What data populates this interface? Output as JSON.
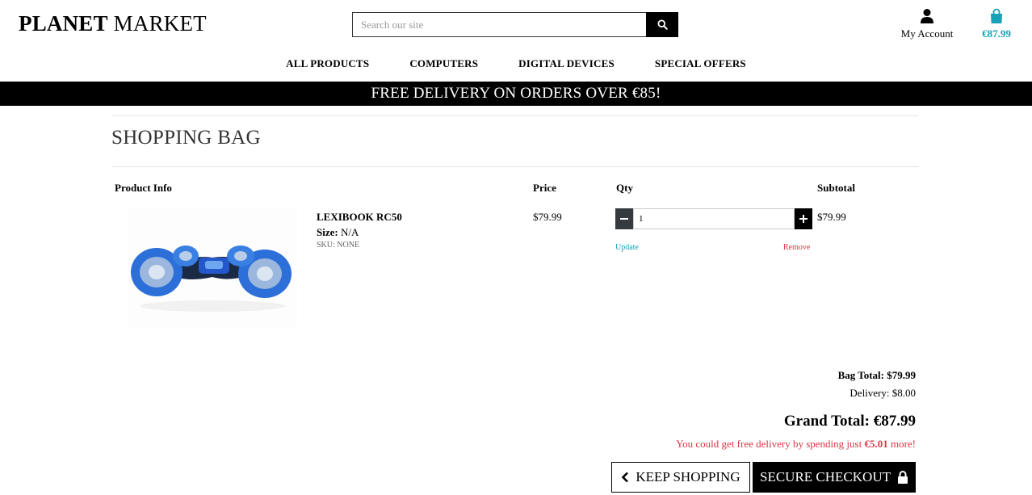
{
  "header": {
    "logo_bold": "PLANET",
    "logo_light": "MARKET",
    "search_placeholder": "Search our site",
    "account_label": "My Account",
    "bag_total": "€87.99",
    "colors": {
      "accent": "#17a2b8",
      "danger": "#dc3545"
    }
  },
  "nav": {
    "items": [
      "ALL PRODUCTS",
      "COMPUTERS",
      "DIGITAL DEVICES",
      "SPECIAL OFFERS"
    ]
  },
  "banner": "FREE DELIVERY ON ORDERS OVER €85!",
  "bag": {
    "title": "SHOPPING BAG",
    "columns": [
      "Product Info",
      "Price",
      "Qty",
      "Subtotal"
    ],
    "item": {
      "name": "LEXIBOOK RC50",
      "size_label": "Size:",
      "size_value": "N/A",
      "sku": "SKU: NONE",
      "price": "$79.99",
      "qty": "1",
      "subtotal": "$79.99",
      "update_label": "Update",
      "remove_label": "Remove"
    },
    "totals": {
      "bag_total": "Bag Total: $79.99",
      "delivery": "Delivery: $8.00",
      "grand_total": "Grand Total: €87.99",
      "free_msg_pre": "You could get free delivery by spending just ",
      "free_msg_amount": "€5.01",
      "free_msg_post": " more!"
    },
    "buttons": {
      "keep_shopping": "KEEP SHOPPING",
      "secure_checkout": "SECURE CHECKOUT"
    }
  }
}
